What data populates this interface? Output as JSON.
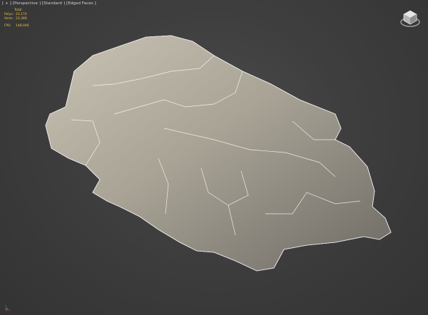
{
  "viewport": {
    "label_parts": [
      "[ + ]",
      "[Perspective ]",
      "[Standard ]",
      "[Edged Faces ]"
    ]
  },
  "stats": {
    "title": "Total",
    "polys_label": "Polys:",
    "polys_value": "22,174",
    "verts_label": "Verts:",
    "verts_value": "22,369",
    "fps_label": "FPS:",
    "fps_value": "148,046"
  },
  "icons": {
    "viewcube": "viewcube-icon",
    "axis": "axis-tripod-icon"
  },
  "colors": {
    "background": "#3b3b3b",
    "stats_text": "#e8c44a",
    "wire": "#f2f2f2"
  }
}
